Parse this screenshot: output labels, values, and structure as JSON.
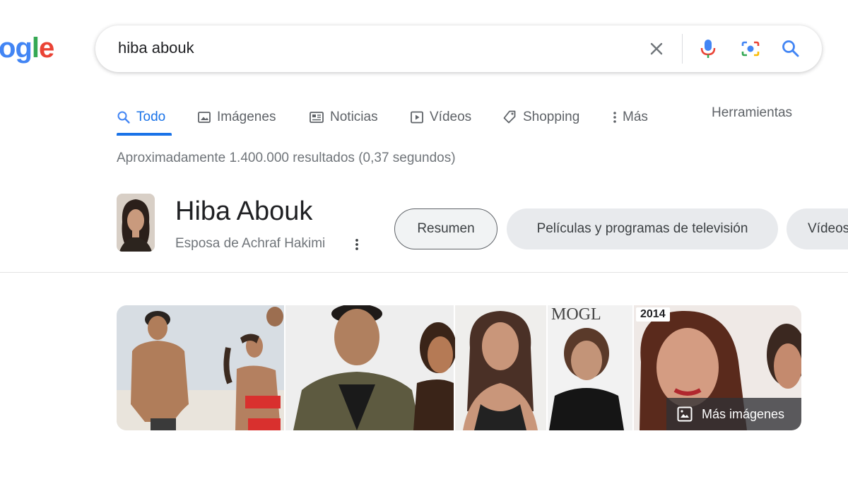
{
  "logo": {
    "text_part1": "o",
    "text_part2": "g",
    "text_part3": "l",
    "text_part4": "e"
  },
  "search": {
    "query": "hiba abouk"
  },
  "tabs": [
    {
      "label": "Todo",
      "icon": "search-icon",
      "active": true
    },
    {
      "label": "Imágenes",
      "icon": "image-icon"
    },
    {
      "label": "Noticias",
      "icon": "news-icon"
    },
    {
      "label": "Vídeos",
      "icon": "play-icon"
    },
    {
      "label": "Shopping",
      "icon": "tag-icon"
    },
    {
      "label": "Más",
      "icon": "more-vert-icon"
    }
  ],
  "tools_label": "Herramientas",
  "result_stats": "Aproximadamente 1.400.000 resultados (0,37 segundos)",
  "entity": {
    "title": "Hiba Abouk",
    "subtitle": "Esposa de Achraf Hakimi",
    "chips": [
      "Resumen",
      "Películas y programas de televisión",
      "Vídeos"
    ]
  },
  "gallery": {
    "year_badge": "2014",
    "more_images_label": "Más imágenes"
  },
  "colors": {
    "accent": "#1a73e8",
    "google_blue": "#4285f4",
    "google_red": "#ea4335",
    "google_yellow": "#fbbc05",
    "google_green": "#34a853"
  }
}
